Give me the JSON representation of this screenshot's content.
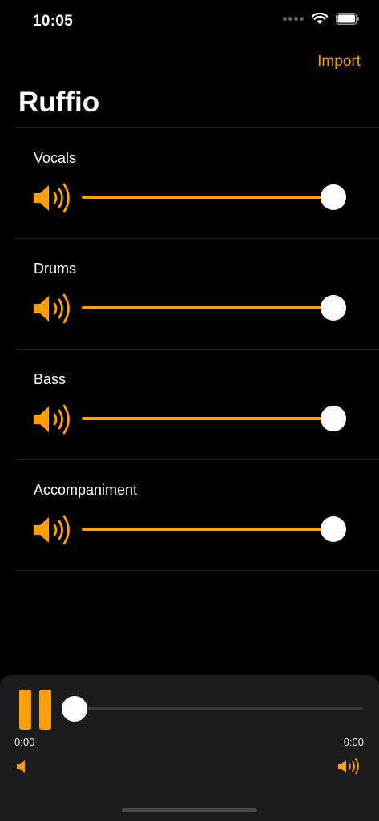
{
  "status_bar": {
    "time": "10:05"
  },
  "header": {
    "import_label": "Import",
    "title": "Ruffio"
  },
  "tracks": [
    {
      "label": "Vocals",
      "volume": 1.0
    },
    {
      "label": "Drums",
      "volume": 1.0
    },
    {
      "label": "Bass",
      "volume": 1.0
    },
    {
      "label": "Accompaniment",
      "volume": 1.0
    }
  ],
  "player": {
    "elapsed": "0:00",
    "total": "0:00",
    "progress": 0.0
  },
  "colors": {
    "accent": "#ff9f0a",
    "background": "#000000",
    "panel": "#1c1c1e"
  },
  "icons": {
    "track": "speaker-wave-3-icon",
    "play_state": "pause-icon",
    "volume_low": "speaker-icon",
    "volume_high": "speaker-wave-3-icon"
  }
}
